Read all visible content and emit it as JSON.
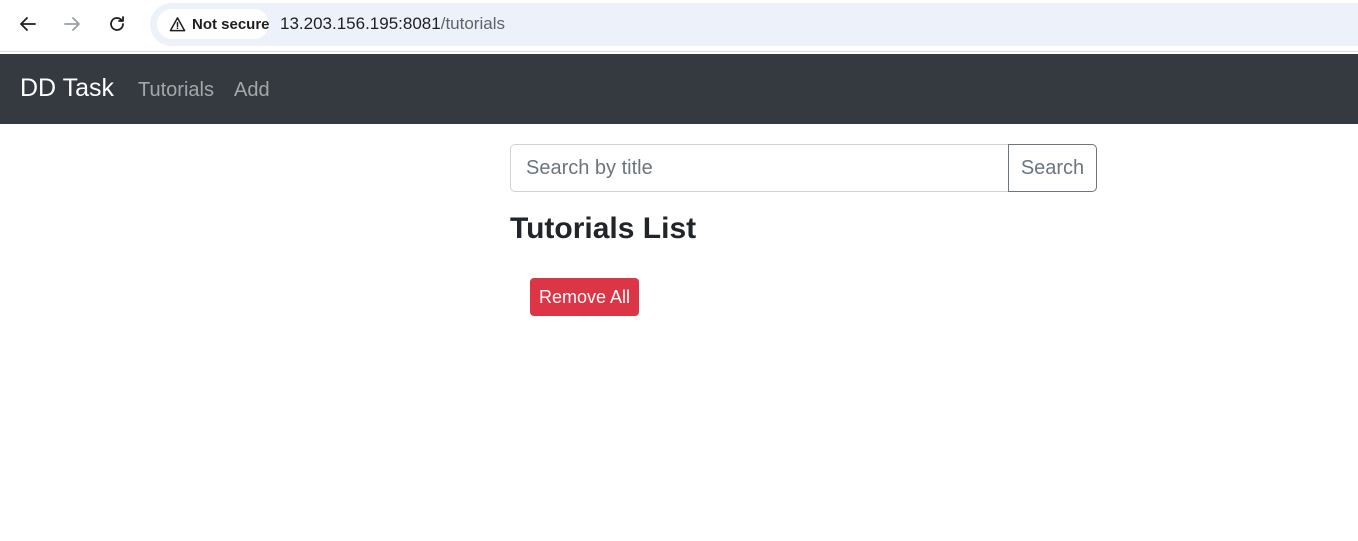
{
  "browser": {
    "security_label": "Not secure",
    "url_host": "13.203.156.195:8081",
    "url_path": "/tutorials",
    "icons": {
      "back": "arrow-left-icon",
      "forward": "arrow-right-icon",
      "reload": "reload-icon",
      "security": "warning-triangle-icon"
    }
  },
  "navbar": {
    "brand": "DD Task",
    "links": [
      {
        "label": "Tutorials"
      },
      {
        "label": "Add"
      }
    ],
    "background": "#343a40"
  },
  "search": {
    "placeholder": "Search by title",
    "value": "",
    "button_label": "Search"
  },
  "main": {
    "title": "Tutorials List",
    "remove_all_label": "Remove All",
    "danger_color": "#dc3545"
  }
}
